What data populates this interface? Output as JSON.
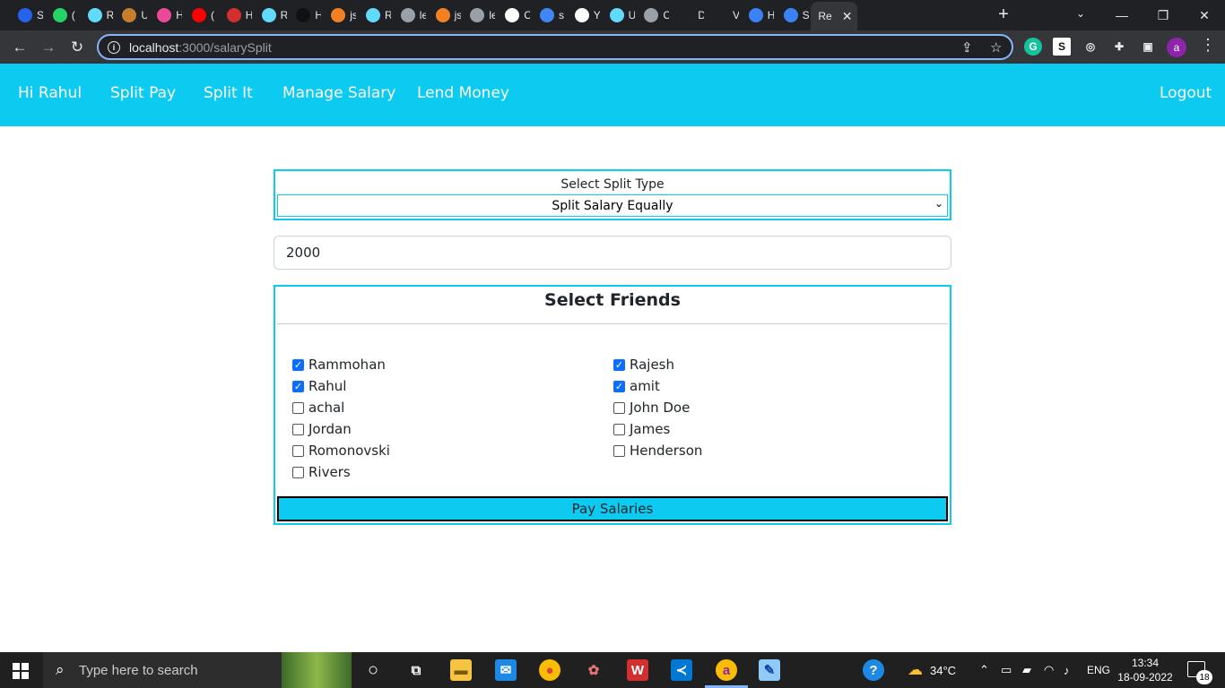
{
  "browser": {
    "tabs": [
      {
        "letter": "S",
        "icon": "r-icon",
        "color": "#2563eb"
      },
      {
        "letter": "(",
        "icon": "whatsapp-icon",
        "color": "#25d366"
      },
      {
        "letter": "R",
        "icon": "react-icon",
        "color": "#61dafb"
      },
      {
        "letter": "U",
        "icon": "chest-icon",
        "color": "#c77d2e"
      },
      {
        "letter": "H",
        "icon": "play-icon",
        "color": "#ec4899"
      },
      {
        "letter": "(",
        "icon": "youtube-icon",
        "color": "#ff0000"
      },
      {
        "letter": "H",
        "icon": "hd-icon",
        "color": "#d32f2f"
      },
      {
        "letter": "R",
        "icon": "react-icon",
        "color": "#61dafb"
      },
      {
        "letter": "H",
        "icon": "a-icon",
        "color": "#111111"
      },
      {
        "letter": "js",
        "icon": "stackoverflow-icon",
        "color": "#f48024"
      },
      {
        "letter": "R",
        "icon": "react-icon",
        "color": "#61dafb"
      },
      {
        "letter": "le",
        "icon": "globe-icon",
        "color": "#9aa0a6"
      },
      {
        "letter": "js",
        "icon": "stackoverflow-icon",
        "color": "#f48024"
      },
      {
        "letter": "le",
        "icon": "globe-icon",
        "color": "#9aa0a6"
      },
      {
        "letter": "C",
        "icon": "globe-icon",
        "color": "#ffffff"
      },
      {
        "letter": "s",
        "icon": "google-icon",
        "color": "#4285f4"
      },
      {
        "letter": "Y",
        "icon": "github-icon",
        "color": "#ffffff"
      },
      {
        "letter": "U",
        "icon": "react-icon",
        "color": "#61dafb"
      },
      {
        "letter": "C",
        "icon": "cube-icon",
        "color": "#9aa0a6"
      },
      {
        "letter": "D",
        "icon": "d-icon",
        "color": "#202124"
      },
      {
        "letter": "V",
        "icon": "d-icon",
        "color": "#202124"
      },
      {
        "letter": "H",
        "icon": "c-icon",
        "color": "#3b82f6"
      },
      {
        "letter": "S",
        "icon": "c-icon",
        "color": "#3b82f6"
      },
      {
        "letter": "Re",
        "icon": "none",
        "color": "#35363a"
      }
    ],
    "url_host": "localhost",
    "url_path": ":3000/salarySplit",
    "profile_letter": "a"
  },
  "nav": {
    "brand": "Hi Rahul",
    "links": [
      "Split Pay",
      "Split It",
      "Manage Salary",
      "Lend Money"
    ],
    "logout": "Logout"
  },
  "split": {
    "label": "Select Split Type",
    "selected": "Split Salary Equally"
  },
  "amount": "2000",
  "friends": {
    "title": "Select Friends",
    "left": [
      {
        "name": "Rammohan",
        "checked": true
      },
      {
        "name": "Rahul",
        "checked": true
      },
      {
        "name": "achal",
        "checked": false
      },
      {
        "name": "Jordan",
        "checked": false
      },
      {
        "name": "Romonovski",
        "checked": false
      },
      {
        "name": "Rivers",
        "checked": false
      }
    ],
    "right": [
      {
        "name": "Rajesh",
        "checked": true
      },
      {
        "name": "amit",
        "checked": true
      },
      {
        "name": "John Doe",
        "checked": false
      },
      {
        "name": "James",
        "checked": false
      },
      {
        "name": "Henderson",
        "checked": false
      }
    ]
  },
  "pay_button": "Pay Salaries",
  "taskbar": {
    "search_placeholder": "Type here to search",
    "weather": "34°C",
    "lang": "ENG",
    "time": "13:34",
    "date": "18-09-2022",
    "notifications": "18"
  }
}
